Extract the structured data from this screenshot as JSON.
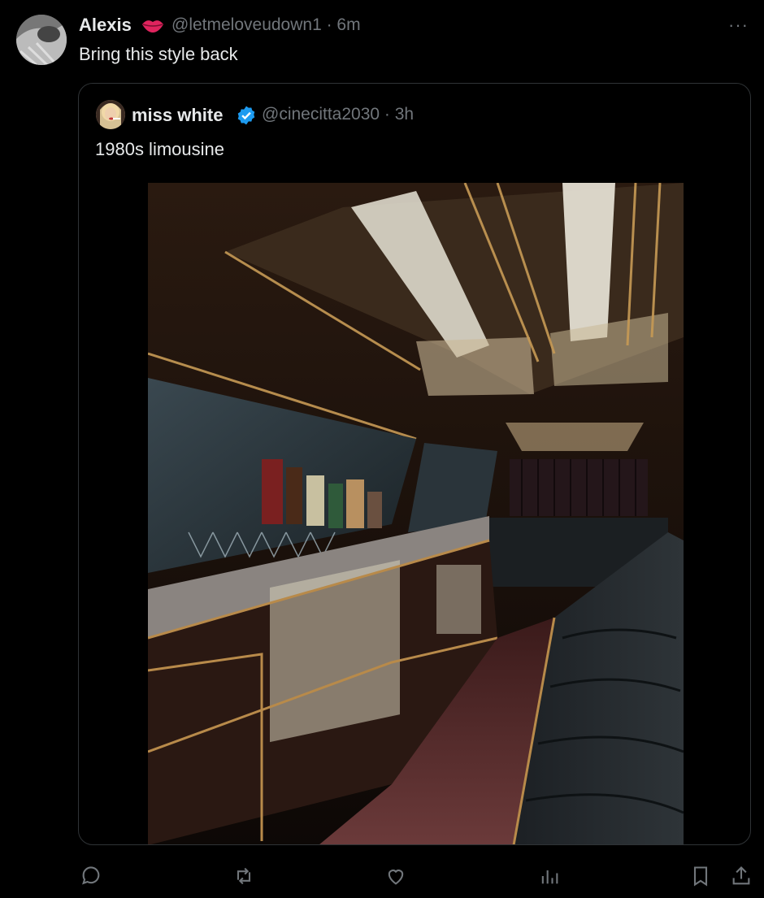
{
  "tweet": {
    "author_name": "Alexis",
    "handle_time": "@letmeloveudown1 · 6m",
    "text": "Bring this style back",
    "more": "···"
  },
  "quoted": {
    "author_name": "miss white",
    "handle_time": "@cinecitta2030 · 3h",
    "text": "1980s limousine",
    "photo_description": "limousine interior photo"
  },
  "icons": {
    "name_emoji": "lips-icon",
    "badge": "verified-badge-icon",
    "actions": [
      "reply-icon",
      "retweet-icon",
      "like-icon",
      "views-icon",
      "bookmark-icon",
      "share-icon"
    ]
  },
  "colors": {
    "background": "#000000",
    "text": "#e7e9ea",
    "muted": "#71767b",
    "border": "#2f3336",
    "verified": "#1d9bf0",
    "lips": "#e0245e"
  }
}
